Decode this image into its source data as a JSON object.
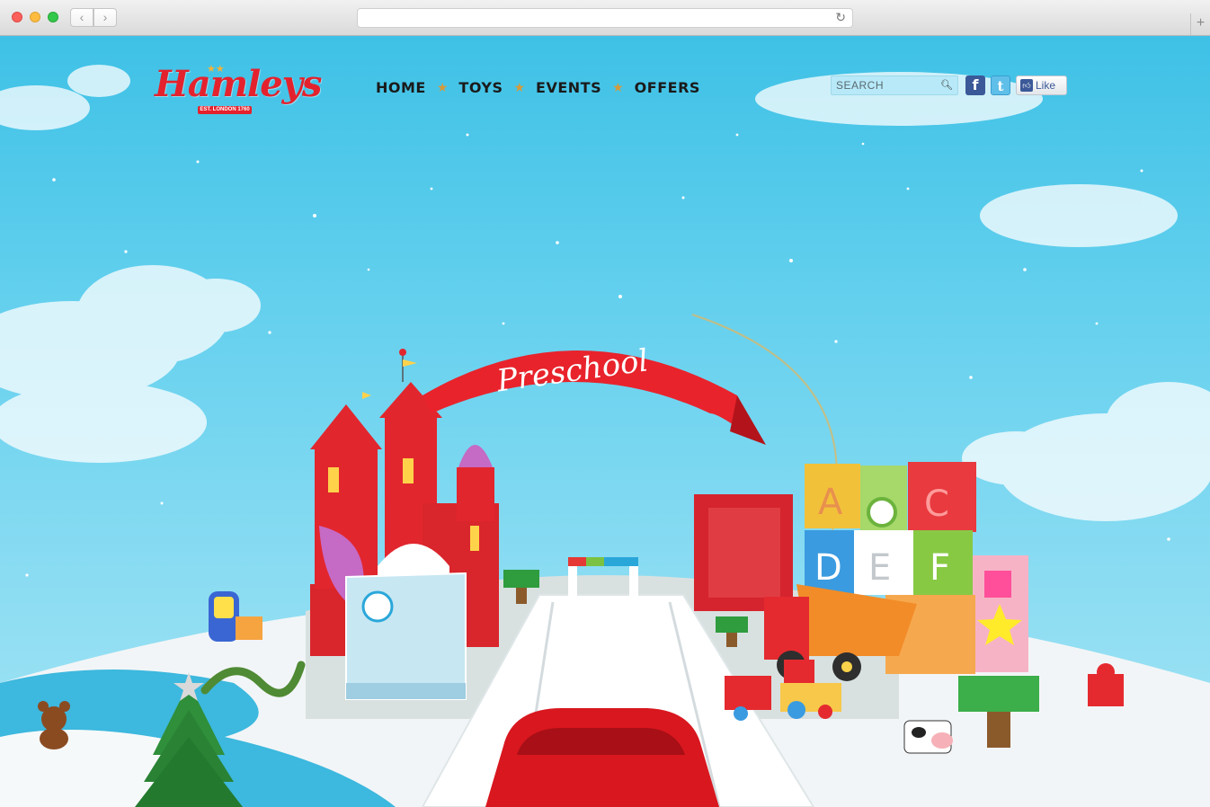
{
  "browser": {
    "back_glyph": "‹",
    "forward_glyph": "›",
    "reload_glyph": "↻",
    "newtab_glyph": "+",
    "url": ""
  },
  "site": {
    "logo": "Hamleys",
    "logo_tagline": "EST. LONDON 1760"
  },
  "nav": {
    "items": [
      {
        "label": "HOME"
      },
      {
        "label": "TOYS"
      },
      {
        "label": "EVENTS"
      },
      {
        "label": "OFFERS"
      }
    ],
    "separator": "★"
  },
  "search": {
    "placeholder": "SEARCH",
    "icon": "magnifier-icon"
  },
  "social": {
    "facebook_glyph": "f",
    "twitter_glyph": "t",
    "like_label": "Like"
  },
  "hero": {
    "banner_label": "Preschool",
    "blocks": [
      "A",
      "C",
      "D",
      "E",
      "F"
    ]
  },
  "colors": {
    "sky_top": "#3ec1e6",
    "sky_bottom": "#a6e4f4",
    "brand_red": "#e4222d",
    "snow": "#ffffff",
    "lake": "#3db8de"
  }
}
